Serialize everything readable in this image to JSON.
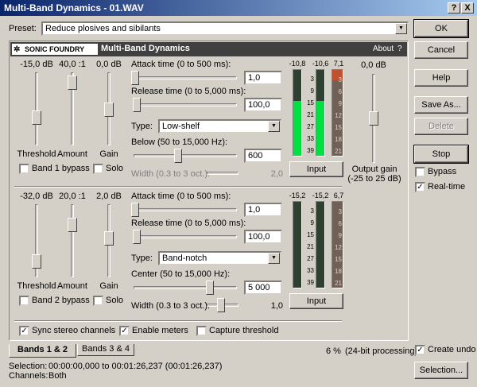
{
  "window": {
    "title": "Multi-Band Dynamics - 01.WAV",
    "help_btn": "?",
    "close_btn": "X"
  },
  "preset": {
    "label": "Preset:",
    "value": "Reduce plosives and sibilants"
  },
  "plugin": {
    "brand": "SONIC FOUNDRY",
    "title": "Multi-Band Dynamics",
    "about": "About",
    "help": "?"
  },
  "buttons": {
    "ok": "OK",
    "cancel": "Cancel",
    "help": "Help",
    "save_as": "Save As...",
    "delete": "Delete",
    "stop": "Stop",
    "selection": "Selection..."
  },
  "options": {
    "bypass": "Bypass",
    "realtime": "Real-time",
    "create_undo": "Create undo"
  },
  "band1": {
    "threshold_val": "-15,0 dB",
    "amount_val": "40,0 :1",
    "gain_val": "0,0 dB",
    "threshold_label": "Threshold",
    "amount_label": "Amount",
    "gain_label": "Gain",
    "bypass": "Band 1 bypass",
    "solo": "Solo",
    "attack_label": "Attack time (0 to 500 ms):",
    "attack_val": "1,0",
    "release_label": "Release time (0 to 5,000 ms):",
    "release_val": "100,0",
    "type_label": "Type:",
    "type_val": "Low-shelf",
    "freq_label": "Below (50 to 15,000 Hz):",
    "freq_val": "600",
    "width_label": "Width (0.3 to 3 oct.):",
    "width_val": "2,0",
    "meter_l": "-10,8",
    "meter_r": "-10,6",
    "gr": "7,1",
    "input_btn": "Input",
    "threshold_frac": 0.62,
    "amount_frac": 0.1,
    "gain_frac": 0.5,
    "attack_frac": 0.0,
    "release_frac": 0.02,
    "freq_frac": 0.45,
    "width_frac": 0.6,
    "meter_l_frac": 0.63,
    "meter_r_frac": 0.63,
    "gr_frac": 0.12
  },
  "band2": {
    "threshold_val": "-32,0 dB",
    "amount_val": "20,0 :1",
    "gain_val": "2,0 dB",
    "threshold_label": "Threshold",
    "amount_label": "Amount",
    "gain_label": "Gain",
    "bypass": "Band 2 bypass",
    "solo": "Solo",
    "attack_label": "Attack time (0 to 500 ms):",
    "attack_val": "1,0",
    "release_label": "Release time (0 to 5,000 ms):",
    "release_val": "100,0",
    "type_label": "Type:",
    "type_val": "Band-notch",
    "freq_label": "Center (50 to 15,000 Hz):",
    "freq_val": "5 000",
    "width_label": "Width (0.3 to 3 oct.):",
    "width_val": "1,0",
    "meter_l": "-15,2",
    "meter_r": "-15,2",
    "gr": "6,7",
    "input_btn": "Input",
    "threshold_frac": 0.8,
    "amount_frac": 0.25,
    "gain_frac": 0.45,
    "attack_frac": 0.0,
    "release_frac": 0.02,
    "freq_frac": 0.78,
    "width_frac": 0.25,
    "meter_l_frac": 0.0,
    "meter_r_frac": 0.0,
    "gr_frac": 0.0
  },
  "meter_scale": [
    "3",
    "9",
    "15",
    "21",
    "27",
    "33",
    "39"
  ],
  "gr_scale": [
    "3",
    "6",
    "9",
    "12",
    "15",
    "18",
    "21"
  ],
  "output": {
    "value": "0,0 dB",
    "label": "Output gain",
    "range": "(-25 to 25 dB)",
    "frac": 0.5
  },
  "checks": {
    "sync": "Sync stereo channels",
    "meters": "Enable meters",
    "capture": "Capture threshold"
  },
  "tabs": [
    {
      "label": "Bands 1 & 2"
    },
    {
      "label": "Bands 3 & 4"
    }
  ],
  "status": {
    "cpu": "6 %",
    "processing": "(24-bit processing)"
  },
  "footer": {
    "selection_label": "Selection:",
    "selection_val": "00:00:00,000 to 00:01:26,237 (00:01:26,237)",
    "channels_label": "Channels:",
    "channels_val": "Both"
  },
  "colors": {
    "meter_green": "#00e040",
    "meter_bg": "#304030",
    "gr_red": "#c05030"
  }
}
